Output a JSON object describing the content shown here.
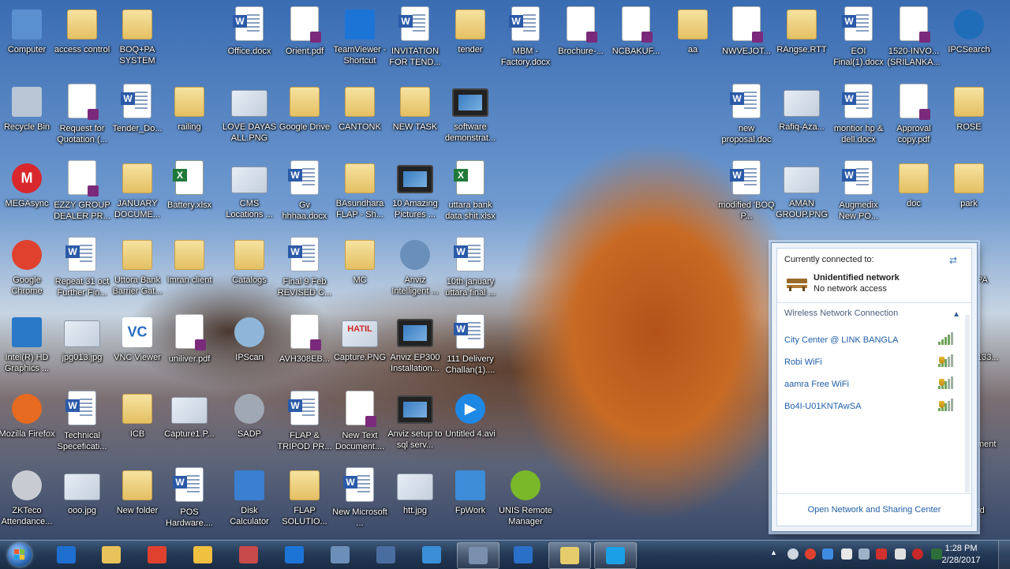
{
  "desktop": {
    "icons": [
      {
        "label": "Computer",
        "type": "app",
        "color": "#5a8fd0"
      },
      {
        "label": "access control",
        "type": "folder"
      },
      {
        "label": "BOQ+PA SYSTEM",
        "type": "folder"
      },
      {
        "label": "Office.docx",
        "type": "doc"
      },
      {
        "label": "Orient.pdf",
        "type": "pdf"
      },
      {
        "label": "TeamViewer - Shortcut",
        "type": "app",
        "color": "#1c74d6"
      },
      {
        "label": "INVITATION FOR TEND...",
        "type": "doc"
      },
      {
        "label": "tender",
        "type": "folder"
      },
      {
        "label": "MBM - Factory.docx",
        "type": "doc"
      },
      {
        "label": "Brochure-...",
        "type": "pdf"
      },
      {
        "label": "NCBAKUF...",
        "type": "pdf"
      },
      {
        "label": "aa",
        "type": "folder"
      },
      {
        "label": "NWVEJOT...",
        "type": "pdf"
      },
      {
        "label": "RAngse.RTT",
        "type": "folder"
      },
      {
        "label": "EOI Final(1).docx",
        "type": "doc"
      },
      {
        "label": "1520-INVO... (SRILANKA...",
        "type": "pdf"
      },
      {
        "label": "IPCSearch",
        "type": "round",
        "color": "#1f6db8"
      },
      {
        "label": "Recycle Bin",
        "type": "app",
        "color": "#b8c6d6"
      },
      {
        "label": "Request for Quotation (...",
        "type": "pdf"
      },
      {
        "label": "Tender_Do...",
        "type": "doc"
      },
      {
        "label": "railing",
        "type": "folder"
      },
      {
        "label": "LOVE DAYAS ALL.PNG",
        "type": "image"
      },
      {
        "label": "Google Drive",
        "type": "folder"
      },
      {
        "label": "CANTONK",
        "type": "folder"
      },
      {
        "label": "NEW TASK",
        "type": "folder"
      },
      {
        "label": "software demonstrat...",
        "type": "video"
      },
      {
        "label": "new proposal.doc",
        "type": "doc"
      },
      {
        "label": "Rafiq-Aza...",
        "type": "image"
      },
      {
        "label": "montior hp & dell.docx",
        "type": "doc"
      },
      {
        "label": "Approval copy.pdf",
        "type": "pdf"
      },
      {
        "label": "ROSE",
        "type": "folder"
      },
      {
        "label": "MEGAsync",
        "type": "round",
        "color": "#d9272e",
        "mark": "M"
      },
      {
        "label": "EZZY GROUP DEALER PR...",
        "type": "pdf"
      },
      {
        "label": "JANUARY DOCUME...",
        "type": "folder"
      },
      {
        "label": "Battery.xlsx",
        "type": "excel"
      },
      {
        "label": "CMS Locations ...",
        "type": "image"
      },
      {
        "label": "Gv hhhaa.docx",
        "type": "doc"
      },
      {
        "label": "BAsundhara FLAP - Sh...",
        "type": "folder"
      },
      {
        "label": "10 Amazing Pictures ...",
        "type": "video"
      },
      {
        "label": "uttara bank data shit.xlsx",
        "type": "excel"
      },
      {
        "label": "modified 'BOQ P...",
        "type": "doc"
      },
      {
        "label": "AMAN GROUP.PNG",
        "type": "image"
      },
      {
        "label": "Augmedix New PO...",
        "type": "doc"
      },
      {
        "label": "doc",
        "type": "folder"
      },
      {
        "label": "park",
        "type": "folder"
      },
      {
        "label": "Google Chrome",
        "type": "round",
        "color": "#e0412f"
      },
      {
        "label": "Repeat 31 oct Further Fin...",
        "type": "doc"
      },
      {
        "label": "Uttora Bank Barrier Gat...",
        "type": "folder"
      },
      {
        "label": "Imran client",
        "type": "folder"
      },
      {
        "label": "Catalogs",
        "type": "folder"
      },
      {
        "label": "Final 9 Feb REVISED C...",
        "type": "doc"
      },
      {
        "label": "MC",
        "type": "folder"
      },
      {
        "label": "Anviz Intelligent ...",
        "type": "round",
        "color": "#6a8fb8"
      },
      {
        "label": "10th january uttara final ...",
        "type": "doc"
      },
      {
        "label": "Intel(R) HD Graphics ...",
        "type": "app",
        "color": "#2a78c8"
      },
      {
        "label": "jpg013.jpg",
        "type": "image"
      },
      {
        "label": "VNC Viewer",
        "type": "app",
        "color": "#ffffff",
        "mark": "VC",
        "markColor": "#2a6cc0"
      },
      {
        "label": "uniliver.pdf",
        "type": "pdf"
      },
      {
        "label": "IPScan",
        "type": "round",
        "color": "#8fb6d8"
      },
      {
        "label": "AVH308EB...",
        "type": "pdf"
      },
      {
        "label": "Capture.PNG",
        "type": "image",
        "mark": "HATIL",
        "markColor": "#d02a2a"
      },
      {
        "label": "Anviz EP300 Installation...",
        "type": "video"
      },
      {
        "label": "111 Delivery Challan(1)....",
        "type": "doc"
      },
      {
        "label": "Mozilla Firefox",
        "type": "round",
        "color": "#e66a1f"
      },
      {
        "label": "Technical Speceficati...",
        "type": "doc"
      },
      {
        "label": "ICB",
        "type": "folder"
      },
      {
        "label": "Capture1.P...",
        "type": "image"
      },
      {
        "label": "SADP",
        "type": "round",
        "color": "#a0a8b4"
      },
      {
        "label": "FLAP & TRIPOD PR...",
        "type": "doc"
      },
      {
        "label": "New Text Document....",
        "type": "pdf"
      },
      {
        "label": "Anviz setup to sql serv...",
        "type": "video"
      },
      {
        "label": "Untitled 4.avi",
        "type": "round",
        "color": "#1e88e5",
        "mark": "▶"
      },
      {
        "label": "ZKTeco Attendance...",
        "type": "round",
        "color": "#c8ccd2"
      },
      {
        "label": "ooo.jpg",
        "type": "image"
      },
      {
        "label": "New folder",
        "type": "folder"
      },
      {
        "label": "POS Hardware....",
        "type": "doc"
      },
      {
        "label": "Disk Calculator",
        "type": "app",
        "color": "#3a7fd0"
      },
      {
        "label": "FLAP SOLUTIO...",
        "type": "folder"
      },
      {
        "label": "New Microsoft ...",
        "type": "doc"
      },
      {
        "label": "htt.jpg",
        "type": "image"
      },
      {
        "label": "FpWork",
        "type": "app",
        "color": "#3c8cd8"
      },
      {
        "label": "UNIS Remote Manager",
        "type": "round",
        "color": "#7ab82a"
      }
    ],
    "partial_right": [
      {
        "label": "PA"
      },
      {
        "label": "133..."
      },
      {
        "label": "ment"
      },
      {
        "label": "rd"
      }
    ]
  },
  "network_flyout": {
    "header": "Currently connected to:",
    "connection_name": "Unidentified network",
    "connection_status": "No network access",
    "section_title": "Wireless Network Connection",
    "networks": [
      {
        "name": "City Center @ LINK BANGLA",
        "secured": false,
        "strength": 4
      },
      {
        "name": "Robi WiFi",
        "secured": true,
        "strength": 3
      },
      {
        "name": "aamra Free WiFi",
        "secured": true,
        "strength": 3
      },
      {
        "name": "Bo4I-U01KNTAwSA",
        "secured": true,
        "strength": 3
      }
    ],
    "footer_link": "Open Network and Sharing Center"
  },
  "taskbar": {
    "start_label": "Start",
    "buttons": [
      {
        "name": "internet-explorer",
        "color": "#1e6fcf",
        "active": false
      },
      {
        "name": "file-explorer",
        "color": "#e8c25a",
        "active": false
      },
      {
        "name": "chrome",
        "color": "#e0412f",
        "active": false
      },
      {
        "name": "mail",
        "color": "#f0c040",
        "active": false
      },
      {
        "name": "snipping-tool",
        "color": "#c84a4a",
        "active": false
      },
      {
        "name": "teamviewer",
        "color": "#1c74d6",
        "active": false
      },
      {
        "name": "ipcsearch",
        "color": "#6b8fb8",
        "active": false
      },
      {
        "name": "media-player",
        "color": "#4a6da0",
        "active": false
      },
      {
        "name": "network-share",
        "color": "#3a8fd8",
        "active": false
      },
      {
        "name": "video-app",
        "color": "#7a8fae",
        "active": true
      },
      {
        "name": "outlook",
        "color": "#2a6fc8",
        "active": false
      },
      {
        "name": "sticky-folder",
        "color": "#e6cc6a",
        "active": true
      },
      {
        "name": "skype",
        "color": "#1aa0e6",
        "active": true
      }
    ],
    "clock_time": "1:28 PM",
    "clock_date": "2/28/2017"
  }
}
